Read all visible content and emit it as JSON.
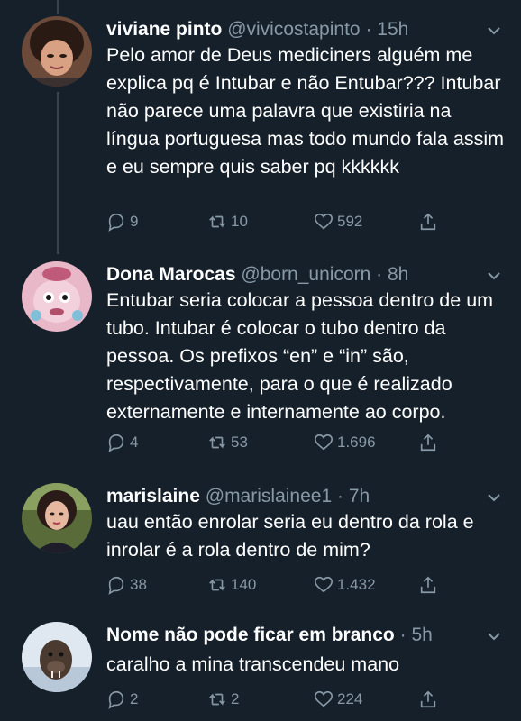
{
  "tweets": [
    {
      "name": "viviane pinto",
      "handle": "@vivicostapinto",
      "time": "15h",
      "text": "Pelo amor de Deus mediciners alguém me explica pq é Intubar e não Entubar??? Intubar não parece uma palavra que existiria na língua portuguesa mas todo mundo fala assim e eu sempre quis saber pq kkkkkk",
      "replies": "9",
      "retweets": "10",
      "likes": "592"
    },
    {
      "name": "Dona Marocas",
      "handle": "@born_unicorn",
      "time": "8h",
      "text": "Entubar seria colocar a pessoa dentro de um tubo. Intubar é colocar o tubo dentro da pessoa. Os prefixos “en” e “in” são, respectivamente, para o que é realizado externamente e internamente ao corpo.",
      "replies": "4",
      "retweets": "53",
      "likes": "1.696"
    },
    {
      "name": "marislaine",
      "handle": "@marislainee1",
      "time": "7h",
      "text": "uau então enrolar seria eu dentro da rola e inrolar é a rola dentro de mim?",
      "replies": "38",
      "retweets": "140",
      "likes": "1.432"
    },
    {
      "name": "Nome não pode ficar em branco",
      "handle": "",
      "time": "5h",
      "text": "caralho a mina transcendeu mano",
      "replies": "2",
      "retweets": "2",
      "likes": "224"
    }
  ],
  "separator": "·",
  "colors": {
    "background": "#15202b",
    "secondary_text": "#8899a6",
    "thread_line": "#38444d"
  },
  "icons": [
    "reply-icon",
    "retweet-icon",
    "like-icon",
    "share-icon",
    "chevron-down-icon"
  ]
}
